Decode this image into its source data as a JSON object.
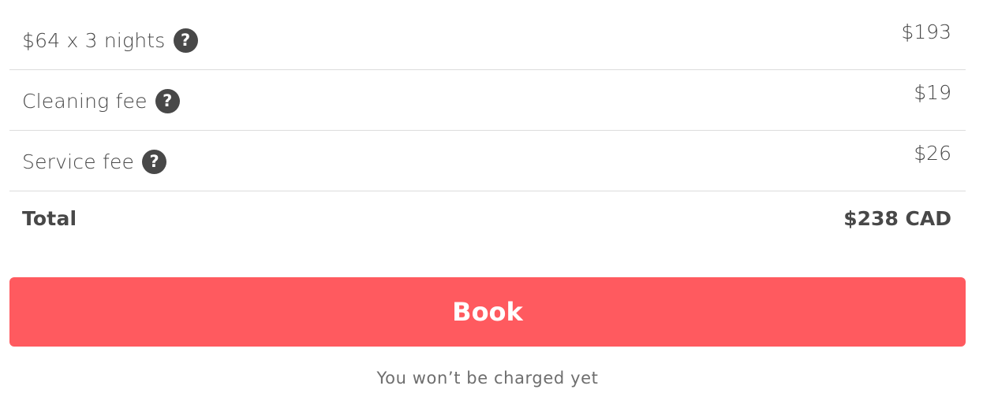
{
  "price_breakdown": {
    "items": [
      {
        "label": "$64 x 3 nights",
        "value": "$193",
        "help_icon": "question-circle-icon"
      },
      {
        "label": "Cleaning fee",
        "value": "$19",
        "help_icon": "question-circle-icon"
      },
      {
        "label": "Service fee",
        "value": "$26",
        "help_icon": "question-circle-icon"
      }
    ],
    "total": {
      "label": "Total",
      "value": "$238 CAD"
    }
  },
  "help_glyph": "?",
  "book_button": {
    "label": "Book"
  },
  "note": "You won’t be charged yet",
  "colors": {
    "accent": "#ff5a5f",
    "text": "#484848",
    "muted": "#6e6e6e",
    "divider": "#dcdcdc"
  }
}
